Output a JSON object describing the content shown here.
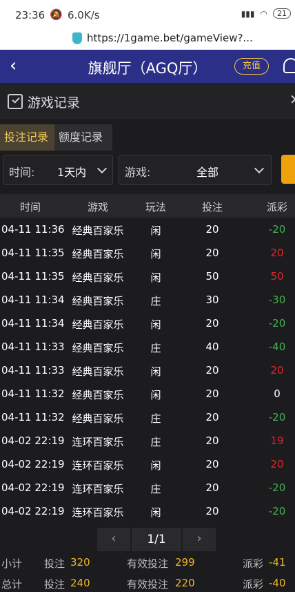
{
  "status": {
    "time": "23:36",
    "speed": "6.0K/s",
    "battery": "21"
  },
  "browser": {
    "url": "https://1game.bet/gameView?..."
  },
  "header": {
    "title": "旗舰厅（AGQ厅）",
    "recharge": "充值"
  },
  "records": {
    "title": "游戏记录",
    "tab_bet": "投注记录",
    "tab_credit": "额度记录"
  },
  "filters": {
    "time_label": "时间:",
    "time_value": "1天内",
    "game_label": "游戏:",
    "game_value": "全部"
  },
  "table": {
    "columns": [
      "时间",
      "游戏",
      "玩法",
      "投注",
      "派彩"
    ],
    "rows": [
      [
        "04-11 11:36",
        "经典百家乐",
        "闲",
        "20",
        "-20"
      ],
      [
        "04-11 11:35",
        "经典百家乐",
        "闲",
        "20",
        "20"
      ],
      [
        "04-11 11:35",
        "经典百家乐",
        "闲",
        "50",
        "50"
      ],
      [
        "04-11 11:34",
        "经典百家乐",
        "庄",
        "30",
        "-30"
      ],
      [
        "04-11 11:34",
        "经典百家乐",
        "闲",
        "20",
        "-20"
      ],
      [
        "04-11 11:33",
        "经典百家乐",
        "庄",
        "40",
        "-40"
      ],
      [
        "04-11 11:33",
        "经典百家乐",
        "闲",
        "20",
        "20"
      ],
      [
        "04-11 11:32",
        "经典百家乐",
        "闲",
        "20",
        "0"
      ],
      [
        "04-11 11:32",
        "经典百家乐",
        "庄",
        "20",
        "-20"
      ],
      [
        "04-02 22:19",
        "连环百家乐",
        "庄",
        "20",
        "19"
      ],
      [
        "04-02 22:19",
        "连环百家乐",
        "闲",
        "20",
        "20"
      ],
      [
        "04-02 22:19",
        "连环百家乐",
        "庄",
        "20",
        "-20"
      ],
      [
        "04-02 22:19",
        "连环百家乐",
        "闲",
        "20",
        "-20"
      ]
    ]
  },
  "pager": {
    "prev": "‹",
    "current": "1/1",
    "next": "›"
  },
  "subtotal": {
    "label": "小计",
    "bet_label": "投注",
    "bet": "320",
    "valid_label": "有效投注",
    "valid": "299",
    "payout_label": "派彩",
    "payout": "-41"
  },
  "total": {
    "label": "总计",
    "bet_label": "投注",
    "bet": "240",
    "valid_label": "有效投注",
    "valid": "220",
    "payout_label": "派彩",
    "payout": "-40"
  },
  "colors": {
    "header_bg": "#2b2f88",
    "accent_gold": "#f0b429",
    "win": "#e0262a",
    "loss": "#3fb34f"
  }
}
